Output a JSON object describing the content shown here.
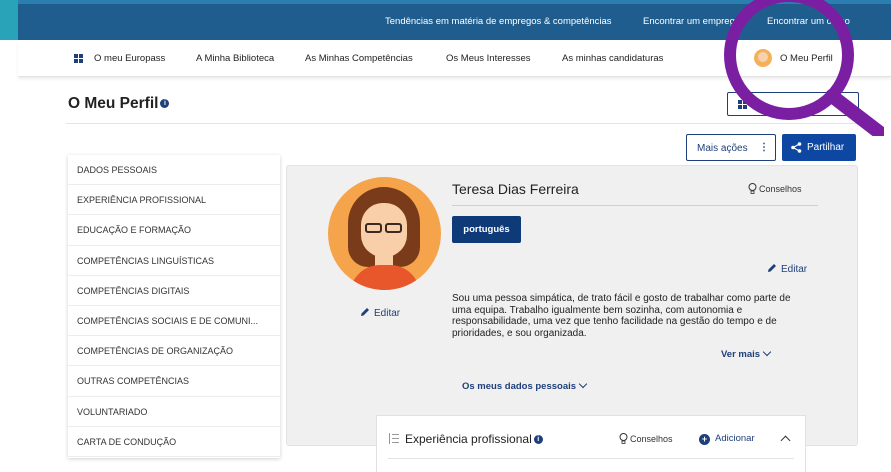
{
  "top_bar": {
    "links": [
      "Tendências em matéria de empregos & competências",
      "Encontrar um emprego",
      "Encontrar um curso"
    ]
  },
  "nav": {
    "items": [
      "O meu Europass",
      "A Minha Biblioteca",
      "As Minhas Competências",
      "Os Meus Interesses",
      "As minhas candidaturas"
    ],
    "profile_label": "O Meu Perfil"
  },
  "page": {
    "title": "O Meu Perfil",
    "info_symbol": "i"
  },
  "actions": {
    "more_label": "Mais ações",
    "more_symbol": "⋮",
    "share_label": "Partilhar"
  },
  "sidebar": {
    "items": [
      "DADOS PESSOAIS",
      "EXPERIÊNCIA PROFISSIONAL",
      "EDUCAÇÃO E FORMAÇÃO",
      "COMPETÊNCIAS LINGUÍSTICAS",
      "COMPETÊNCIAS DIGITAIS",
      "COMPETÊNCIAS SOCIAIS E DE COMUNI...",
      "COMPETÊNCIAS DE ORGANIZAÇÃO",
      "OUTRAS COMPETÊNCIAS",
      "VOLUNTARIADO",
      "CARTA DE CONDUÇÃO"
    ]
  },
  "profile": {
    "name": "Teresa Dias Ferreira",
    "tips_label": "Conselhos",
    "language_badge": "português",
    "edit_label": "Editar",
    "bio": "Sou uma pessoa simpática, de trato fácil e gosto de trabalhar como parte de uma equipa. Trabalho igualmente bem sozinha, com autonomia e responsabilidade, uma vez que tenho facilidade na gestão do tempo e de prioridades, e sou organizada.",
    "see_more": "Ver mais",
    "personal_data_link": "Os meus dados pessoais"
  },
  "experience": {
    "title": "Experiência profissional",
    "info_symbol": "i",
    "tips_label": "Conselhos",
    "add_label": "Adicionar",
    "add_symbol": "+"
  },
  "colors": {
    "top_bar": "#1f5d8f",
    "primary": "#0d47a1",
    "badge": "#0e3a78",
    "magnifier": "#7b1fa2"
  },
  "icons": [
    "grid-icon",
    "chevron-down-icon",
    "kebab-icon",
    "share-icon",
    "bulb-icon",
    "pencil-icon",
    "plus-circle-icon",
    "chevron-up-icon",
    "list-icon",
    "magnifier-icon"
  ]
}
